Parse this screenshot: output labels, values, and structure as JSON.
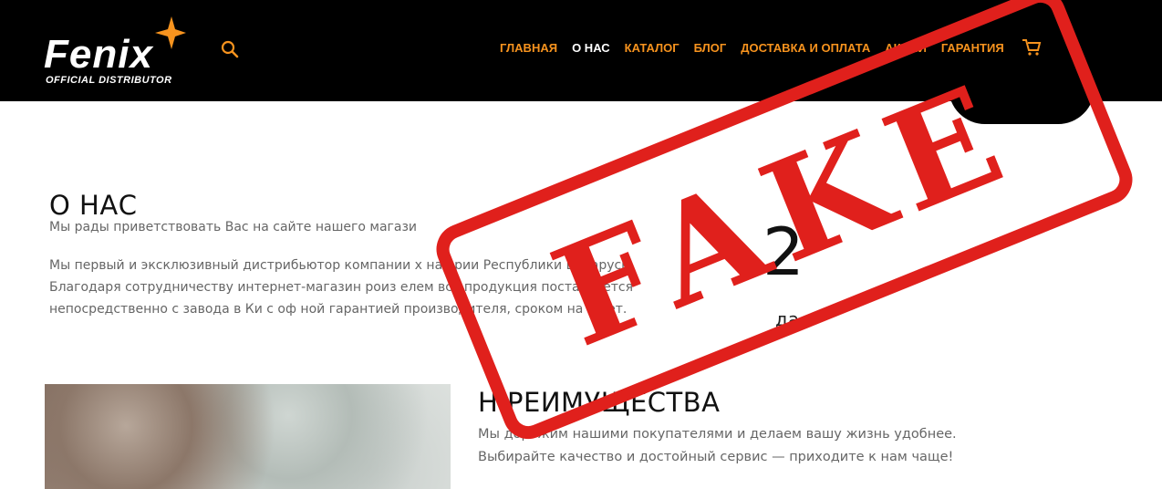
{
  "header": {
    "logo": {
      "word": "Fenix",
      "subtitle": "OFFICIAL DISTRIBUTOR"
    },
    "nav": [
      {
        "label": "ГЛАВНАЯ",
        "active": false
      },
      {
        "label": "О НАС",
        "active": true
      },
      {
        "label": "КАТАЛОГ",
        "active": false
      },
      {
        "label": "БЛОГ",
        "active": false
      },
      {
        "label": "ДОСТАВКА И ОПЛАТА",
        "active": false
      },
      {
        "label": "АКЦИИ",
        "active": false
      },
      {
        "label": "ГАРАНТИЯ",
        "active": false
      }
    ],
    "icons": [
      "search-icon",
      "cart-icon"
    ],
    "colors": {
      "background": "#000000",
      "accent": "#f7931e",
      "active": "#ffffff"
    }
  },
  "main": {
    "title": "О НАС",
    "intro": "Мы рады приветствовать Вас на сайте нашего магази",
    "description": "Мы первый и эксклюзивный дистрибьютор компании    х на        ории Республики Беларусь. Благодаря сотрудничеству интернет-магазин      роиз     елем вся продукция поставляется непосредственно с завода в Ки     с оф      ной гарантией производителя, сроком на 5 лет.",
    "big_number": "2",
    "big_number_caption": "да",
    "advantages": {
      "title": "Н     РЕИМУЩЕСТВА",
      "text_line1": "Мы дорожим нашими покупателями и делаем вашу жизнь удобнее.",
      "text_line2": "Выбирайте качество и достойный сервис — приходите к нам чаще!"
    }
  },
  "overlay": {
    "stamp_text": "FAKE",
    "color": "#e0201c"
  }
}
